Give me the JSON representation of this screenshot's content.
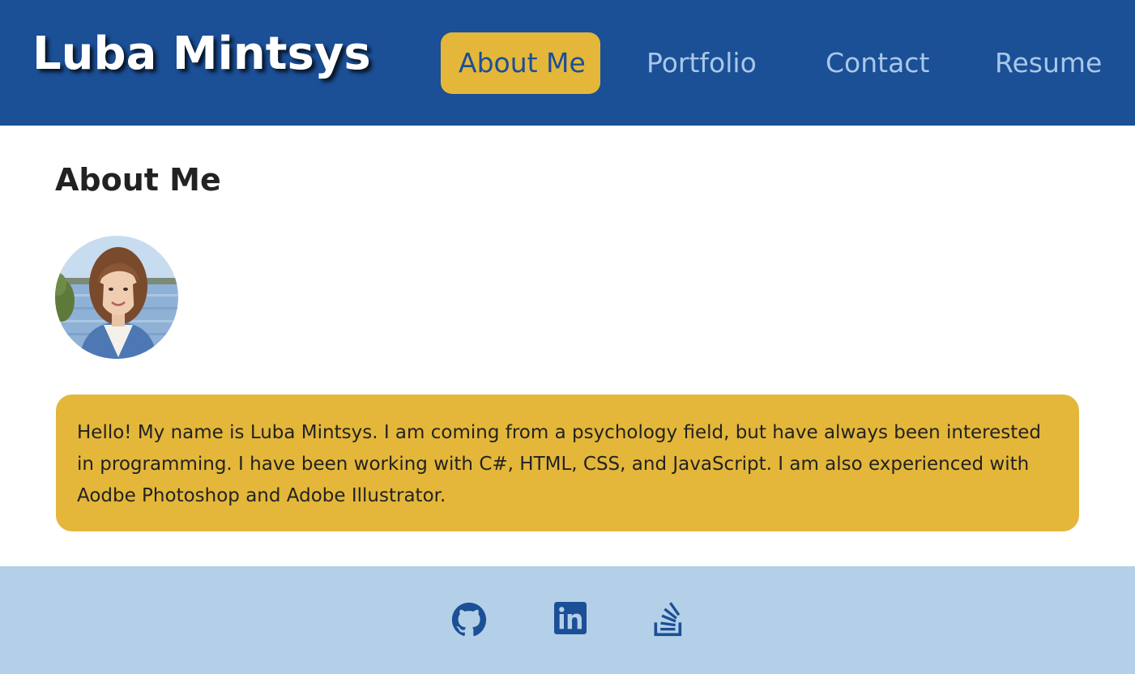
{
  "header": {
    "site_title": "Luba Mintsys",
    "nav": [
      {
        "label": "About Me",
        "active": true
      },
      {
        "label": "Portfolio",
        "active": false
      },
      {
        "label": "Contact",
        "active": false
      },
      {
        "label": "Resume",
        "active": false
      }
    ]
  },
  "main": {
    "section_title": "About Me",
    "avatar_icon": "profile-photo",
    "bio": "Hello! My name is Luba Mintsys. I am coming from a psychology field, but have always been interested in programming. I have been working with C#, HTML, CSS, and JavaScript. I am also experienced with Aodbe Photoshop and Adobe Illustrator."
  },
  "footer": {
    "social": [
      {
        "icon": "github-icon"
      },
      {
        "icon": "linkedin-icon"
      },
      {
        "icon": "stackoverflow-icon"
      }
    ]
  },
  "colors": {
    "header_bg": "#1b4f96",
    "accent": "#e4b73a",
    "nav_inactive": "#a8c8e8",
    "footer_bg": "#b4d0e8"
  }
}
